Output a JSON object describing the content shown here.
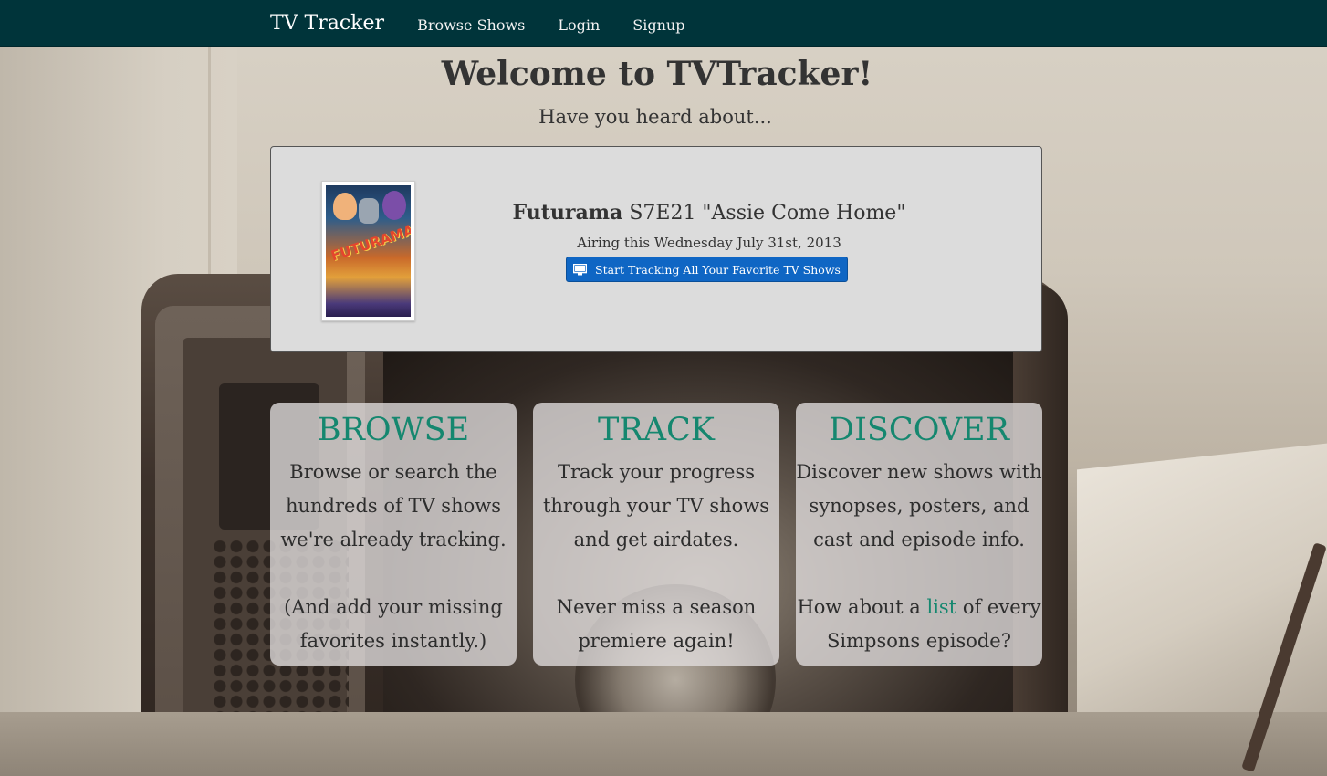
{
  "navbar": {
    "brand": "TV Tracker",
    "links": [
      "Browse Shows",
      "Login",
      "Signup"
    ]
  },
  "welcome": {
    "title": "Welcome to TVTracker!",
    "subtitle": "Have you heard about..."
  },
  "feature": {
    "show_name": "Futurama",
    "episode": "S7E21 \"Assie Come Home\"",
    "airing": "Airing this Wednesday July 31st, 2013",
    "cta_label": "Start Tracking All Your Favorite TV Shows",
    "poster_text": "FUTURAMA"
  },
  "cards": [
    {
      "title": "BROWSE",
      "text1": "Browse or search the hundreds of TV shows we're already tracking.",
      "text2": "(And add your missing favorites instantly.)"
    },
    {
      "title": "TRACK",
      "text1": "Track your progress through your TV shows and get airdates.",
      "text2": "Never miss a season premiere again!"
    },
    {
      "title": "DISCOVER",
      "text1": "Discover new shows with synopses, posters, and cast and episode info.",
      "text2_before": "How about a ",
      "text2_link": "list",
      "text2_after": " of every Simpsons episode?"
    }
  ],
  "colors": {
    "navbar": "#00343a",
    "accent": "#15876f",
    "cta": "#0f66c4"
  },
  "icons": {
    "cta": "monitor-icon"
  }
}
